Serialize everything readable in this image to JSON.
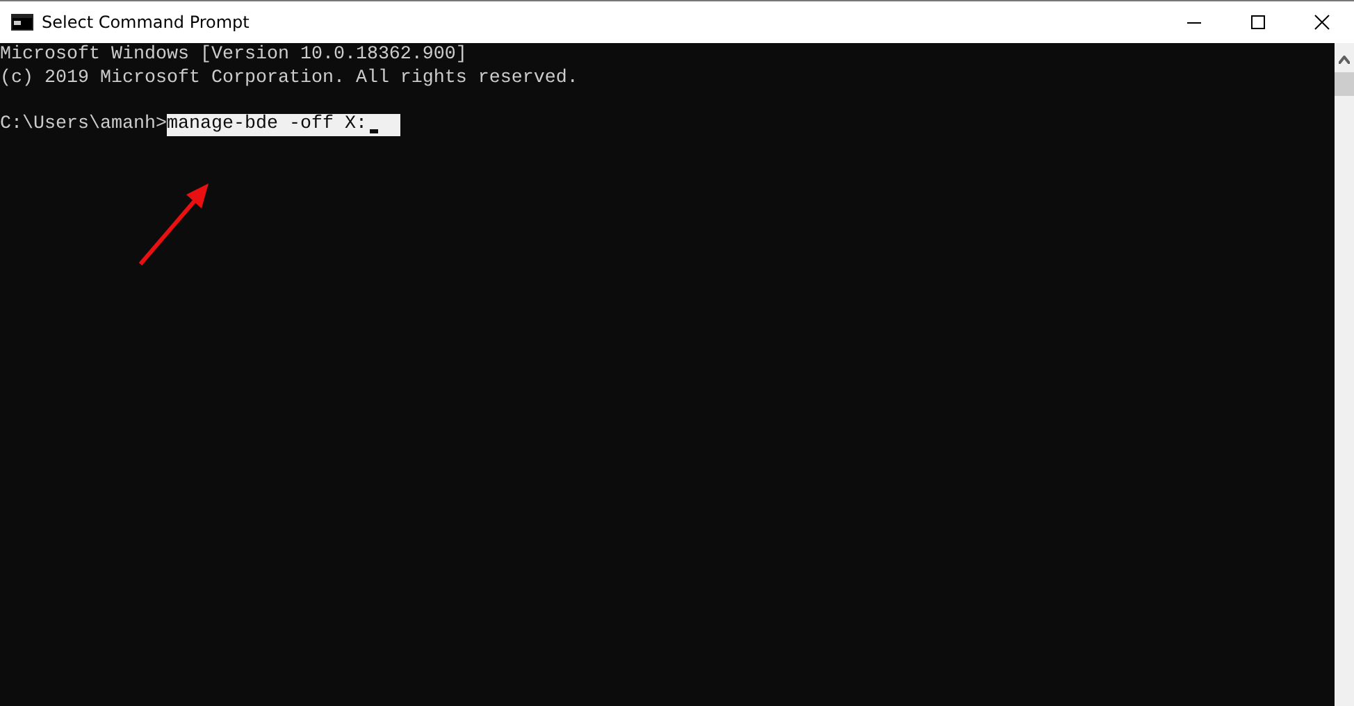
{
  "window": {
    "title": "Select Command Prompt"
  },
  "console": {
    "lines": [
      "Microsoft Windows [Version 10.0.18362.900]",
      "(c) 2019 Microsoft Corporation. All rights reserved."
    ],
    "prompt": "C:\\Users\\amanh>",
    "command": "manage-bde -off X:",
    "selected": true
  }
}
